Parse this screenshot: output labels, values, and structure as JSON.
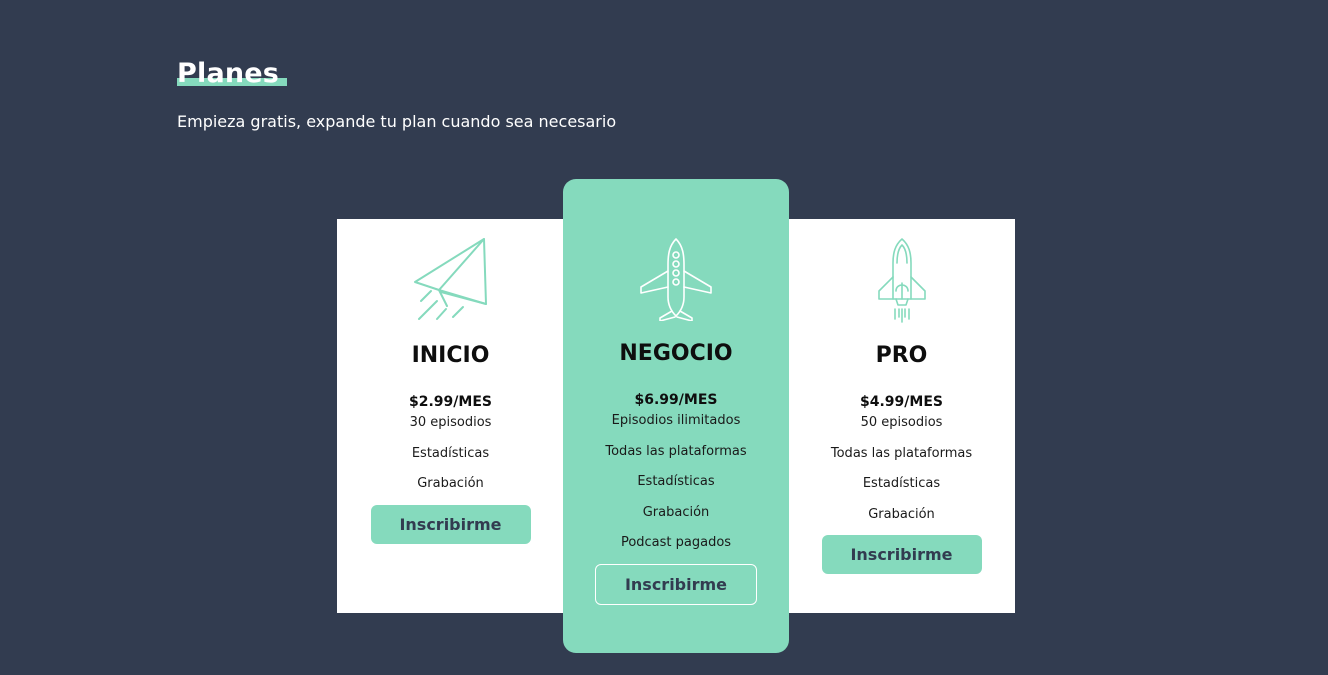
{
  "section": {
    "title": "Planes",
    "subtitle": "Empieza gratis, expande tu plan cuando sea necesario"
  },
  "colors": {
    "background": "#323c50",
    "accent": "#85dabd",
    "card": "#ffffff"
  },
  "plans": [
    {
      "name": "INICIO",
      "icon": "paper-plane-icon",
      "price": "$2.99/MES",
      "features": [
        "30 episodios",
        "Estadísticas",
        "Grabación"
      ],
      "button_label": "Inscribirme"
    },
    {
      "name": "NEGOCIO",
      "icon": "airplane-icon",
      "price": "$6.99/MES",
      "features": [
        "Episodios ilimitados",
        "Todas las plataformas",
        "Estadísticas",
        "Grabación",
        "Podcast pagados"
      ],
      "button_label": "Inscribirme"
    },
    {
      "name": "PRO",
      "icon": "space-shuttle-icon",
      "price": "$4.99/MES",
      "features": [
        "50 episodios",
        "Todas las plataformas",
        "Estadísticas",
        "Grabación"
      ],
      "button_label": "Inscribirme"
    }
  ]
}
